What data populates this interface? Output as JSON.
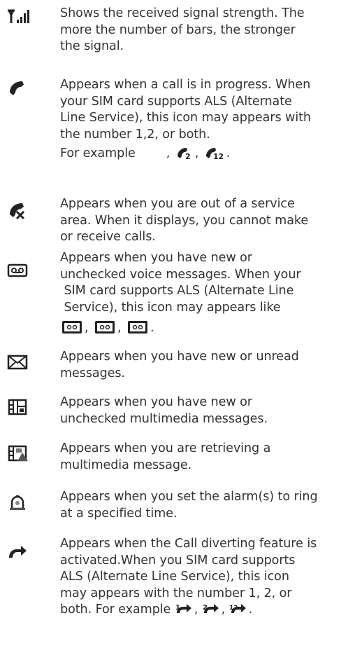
{
  "entries": [
    {
      "icon": "signal-strength-icon",
      "lines": [
        "Shows the received signal strength. The",
        "more the number of bars, the stronger",
        "the signal."
      ]
    },
    {
      "icon": "call-in-progress-icon",
      "lines": [
        "Appears when a call is in progress. When",
        "your SIM card supports ALS (Alternate",
        "Line Service), this icon may appears with",
        "the number 1,2, or both."
      ],
      "example_label": "For example",
      "example_icons": [
        "call-line-1-icon",
        "call-line-2-icon",
        "call-line-12-icon"
      ]
    },
    {
      "icon": "no-service-icon",
      "lines": [
        "Appears when you are out of a service",
        "area. When it displays, you cannot make",
        "or receive calls."
      ]
    },
    {
      "icon": "voicemail-icon",
      "lines": [
        "Appears when you have new or",
        "unchecked voice messages. When your",
        " SIM card supports ALS (Alternate Line",
        " Service), this icon may appears like"
      ],
      "example_icons": [
        "voicemail-line-1-icon",
        "voicemail-line-2-icon",
        "voicemail-line-12-icon"
      ]
    },
    {
      "icon": "envelope-icon",
      "lines": [
        "Appears when you have new or unread",
        "messages."
      ]
    },
    {
      "icon": "multimedia-message-icon",
      "lines": [
        "Appears when you have new or",
        "unchecked multimedia messages."
      ]
    },
    {
      "icon": "retrieving-multimedia-icon",
      "lines": [
        "Appears when you are retrieving a",
        "multimedia message."
      ]
    },
    {
      "icon": "alarm-icon",
      "lines": [
        "Appears when you set the alarm(s) to ring",
        "at a specified time."
      ]
    },
    {
      "icon": "call-divert-icon",
      "lines": [
        "Appears when the Call diverting feature is",
        "activated.When you SIM card supports",
        "ALS (Alternate Line Service), this icon",
        "may appears with the number 1, 2, or"
      ],
      "last_line_prefix": "both. For example",
      "example_icons": [
        "call-divert-line-1-icon",
        "call-divert-line-2-icon",
        "call-divert-line-12-icon"
      ]
    }
  ]
}
